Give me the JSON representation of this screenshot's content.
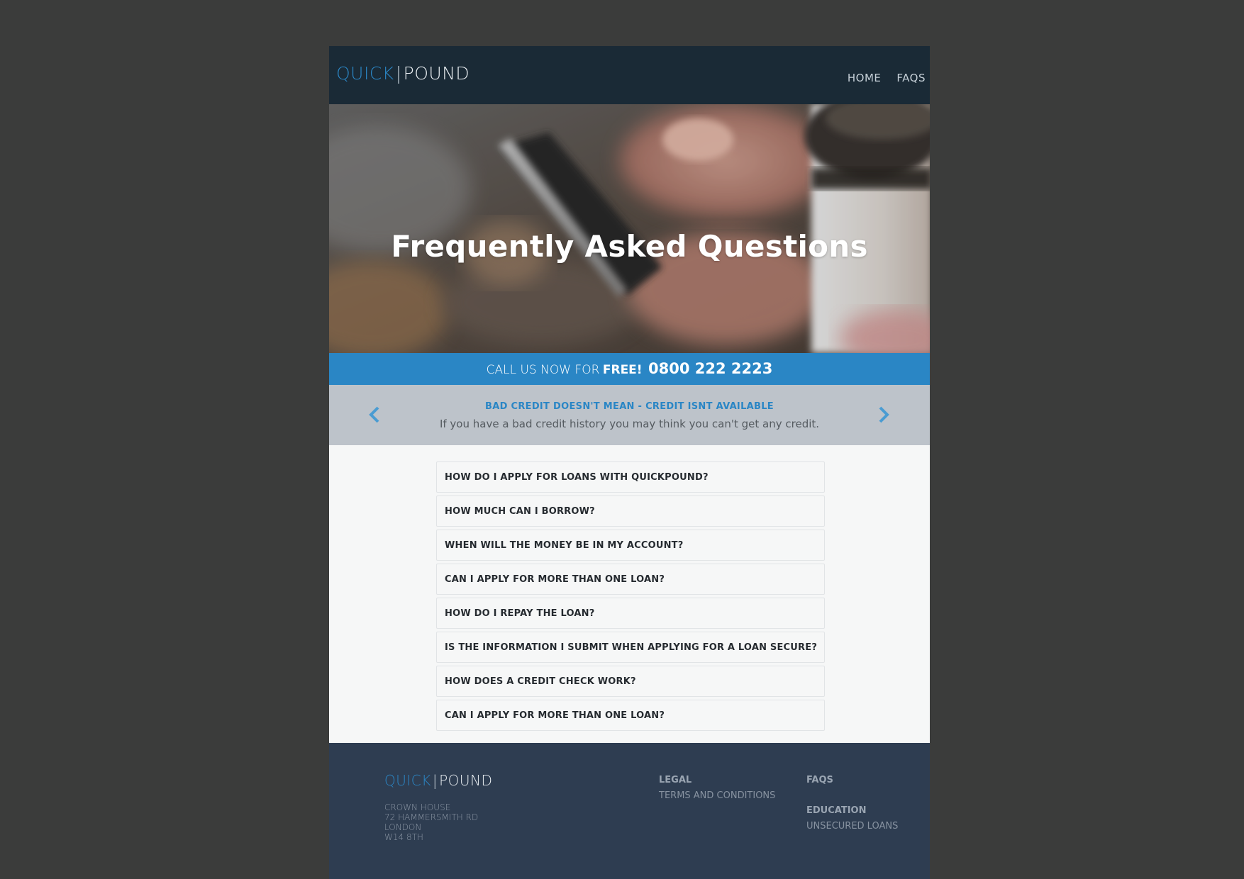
{
  "brand": {
    "logo_quick": "QUICK",
    "logo_sep": "|",
    "logo_pound": "POUND"
  },
  "nav": {
    "home": "HOME",
    "faqs": "FAQS"
  },
  "hero": {
    "title": "Frequently Asked Questions"
  },
  "callbar": {
    "prefix": "CALL US NOW FOR",
    "free": "FREE!",
    "phone": "0800 222 2223"
  },
  "carousel": {
    "title": "BAD CREDIT DOESN'T MEAN - CREDIT ISNT AVAILABLE",
    "text": "If you have a bad credit history you may think you can't get any credit.",
    "prev_icon": "chevron-left-icon",
    "next_icon": "chevron-right-icon"
  },
  "faq": {
    "questions": [
      "HOW DO I APPLY FOR LOANS WITH QUICKPOUND?",
      "HOW MUCH CAN I BORROW?",
      "WHEN WILL THE MONEY BE IN MY ACCOUNT?",
      "CAN I APPLY FOR MORE THAN ONE LOAN?",
      "HOW DO I REPAY THE LOAN?",
      "IS THE INFORMATION I SUBMIT WHEN APPLYING FOR A LOAN SECURE?",
      "HOW DOES A CREDIT CHECK WORK?",
      "CAN I APPLY FOR MORE THAN ONE LOAN?"
    ]
  },
  "footer": {
    "address": [
      "CROWN HOUSE",
      "72 HAMMERSMITH RD",
      "LONDON",
      "W14 8TH"
    ],
    "legal_heading": "LEGAL",
    "terms_link": "TERMS AND CONDITIONS",
    "faqs_heading": "FAQS",
    "education_heading": "EDUCATION",
    "unsecured_link": "UNSECURED LOANS"
  },
  "colors": {
    "background": "#3b3c3b",
    "header": "#1a2a36",
    "accent": "#2a86c5",
    "carousel": "#bdc3ca",
    "footer": "#2e3d51"
  }
}
